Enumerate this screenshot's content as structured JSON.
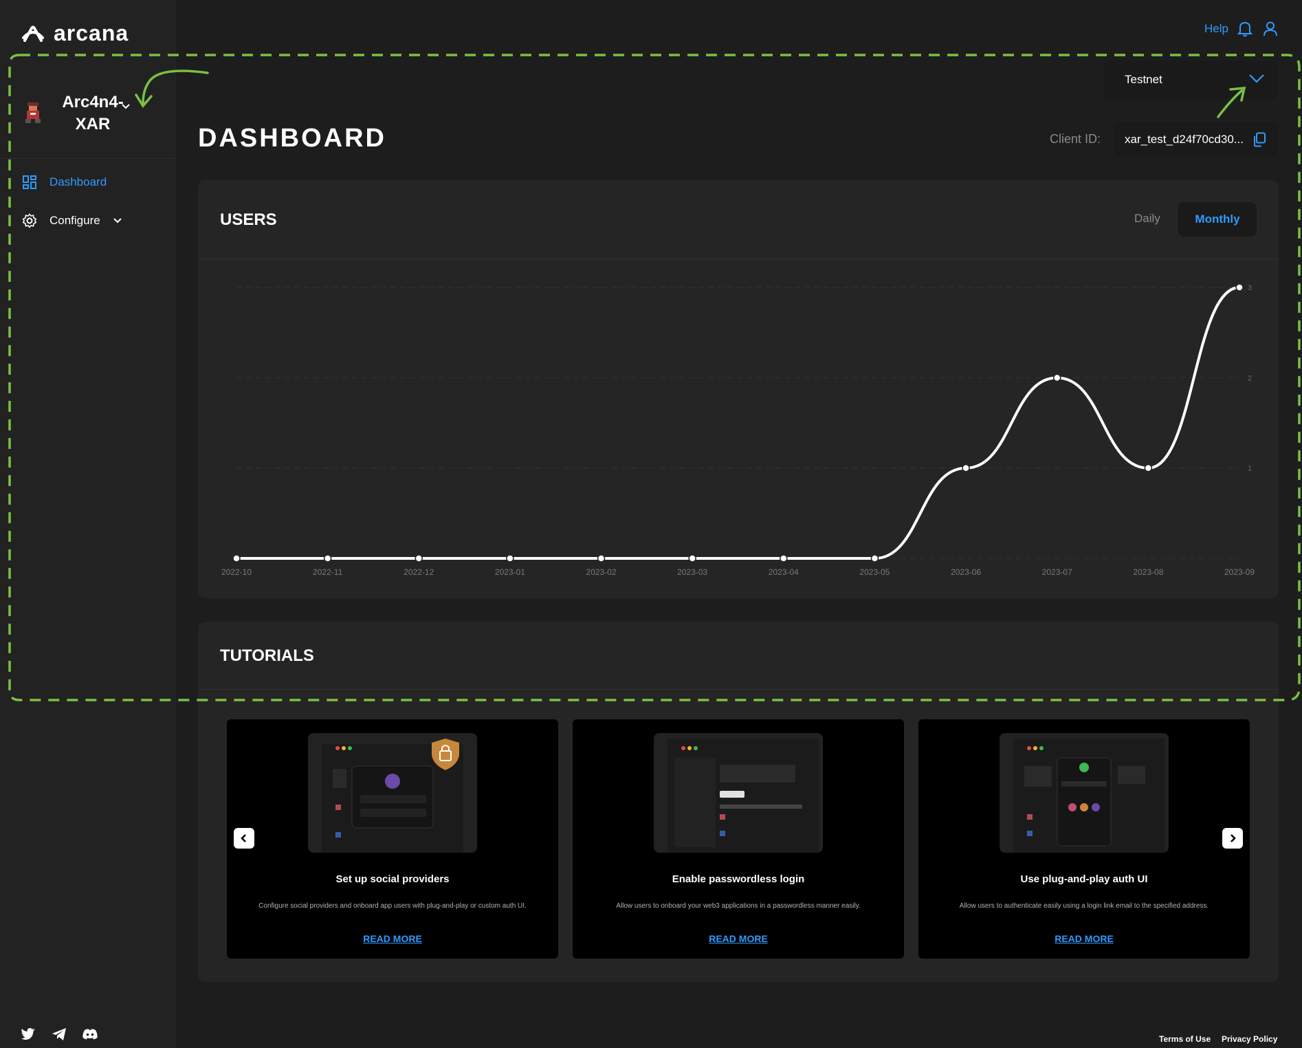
{
  "brand": {
    "name": "arcana"
  },
  "app": {
    "name": "Arc4n4-XAR"
  },
  "sidebar": {
    "items": [
      {
        "label": "Dashboard",
        "icon": "dashboard-icon",
        "active": true
      },
      {
        "label": "Configure",
        "icon": "gear-icon",
        "active": false
      }
    ],
    "social": [
      "twitter-icon",
      "telegram-icon",
      "discord-icon"
    ]
  },
  "topbar": {
    "help": "Help"
  },
  "network": {
    "selected": "Testnet"
  },
  "page": {
    "title": "DASHBOARD"
  },
  "client": {
    "label": "Client ID:",
    "value": "xar_test_d24f70cd30..."
  },
  "users": {
    "title": "USERS",
    "toggle_daily": "Daily",
    "toggle_monthly": "Monthly",
    "selected": "Monthly"
  },
  "chart_data": {
    "type": "line",
    "x": [
      "2022-10",
      "2022-11",
      "2022-12",
      "2023-01",
      "2023-02",
      "2023-03",
      "2023-04",
      "2023-05",
      "2023-06",
      "2023-07",
      "2023-08",
      "2023-09"
    ],
    "values": [
      0,
      0,
      0,
      0,
      0,
      0,
      0,
      0,
      1,
      2,
      1,
      3
    ],
    "y_ticks": [
      "1",
      "2",
      "3"
    ],
    "ylim": [
      0,
      3
    ],
    "grid": true,
    "smooth": true,
    "line_color": "#ffffff"
  },
  "tutorials": {
    "title": "TUTORIALS",
    "cards": [
      {
        "title": "Set up social providers",
        "description": "Configure social providers and onboard app users with plug-and-play or custom auth UI.",
        "link": "READ MORE"
      },
      {
        "title": "Enable passwordless login",
        "description": "Allow users to onboard your web3 applications in a passwordless manner easily.",
        "link": "READ MORE"
      },
      {
        "title": "Use plug-and-play auth UI",
        "description": "Allow users to authenticate easily using a login link email to the specified address.",
        "link": "READ MORE"
      }
    ]
  },
  "footer": {
    "terms": "Terms of Use",
    "privacy": "Privacy Policy"
  },
  "colors": {
    "accent": "#2f9bff",
    "annotation": "#7ac143",
    "background": "#1d1d1d"
  }
}
